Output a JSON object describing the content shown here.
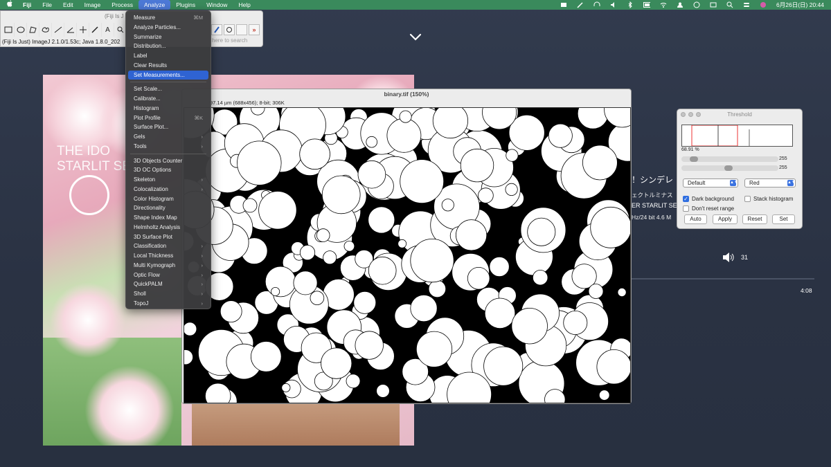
{
  "menubar": {
    "apple": "",
    "items": [
      "Fiji",
      "File",
      "Edit",
      "Image",
      "Process",
      "Analyze",
      "Plugins",
      "Window",
      "Help"
    ],
    "active": "Analyze",
    "clock": "6月26日(日) 20:44"
  },
  "ij_window": {
    "title": "(Fiji Is J",
    "status": "(Fiji Is Just) ImageJ 2.1.0/1.53c; Java 1.8.0_202",
    "search_placeholder": "here to search"
  },
  "analyze_menu": {
    "items": [
      {
        "label": "Measure",
        "shortcut": "⌘M"
      },
      {
        "label": "Analyze Particles..."
      },
      {
        "label": "Summarize"
      },
      {
        "label": "Distribution..."
      },
      {
        "label": "Label"
      },
      {
        "label": "Clear Results"
      },
      {
        "label": "Set Measurements...",
        "selected": true
      },
      {
        "sep": true
      },
      {
        "label": "Set Scale..."
      },
      {
        "label": "Calibrate..."
      },
      {
        "label": "Histogram"
      },
      {
        "label": "Plot Profile",
        "shortcut": "⌘K"
      },
      {
        "label": "Surface Plot..."
      },
      {
        "label": "Gels",
        "submenu": true
      },
      {
        "label": "Tools",
        "submenu": true
      },
      {
        "sep": true
      },
      {
        "label": "3D Objects Counter"
      },
      {
        "label": "3D OC Options"
      },
      {
        "label": "Skeleton",
        "submenu": true
      },
      {
        "label": "Colocalization",
        "submenu": true
      },
      {
        "label": "Color Histogram"
      },
      {
        "label": "Directionality"
      },
      {
        "label": "Shape Index Map"
      },
      {
        "label": "Helmholtz Analysis"
      },
      {
        "label": "3D Surface Plot"
      },
      {
        "label": "Classification",
        "submenu": true
      },
      {
        "label": "Local Thickness",
        "submenu": true
      },
      {
        "label": "Multi Kymograph",
        "submenu": true
      },
      {
        "label": "Optic Flow",
        "submenu": true
      },
      {
        "label": "QuickPALM",
        "submenu": true
      },
      {
        "label": "Sholl",
        "submenu": true
      },
      {
        "label": "TopoJ",
        "submenu": true
      }
    ]
  },
  "binary_window": {
    "title": "binary.tif (150%)",
    "info": "97.14 µm (688x456); 8-bit; 306K"
  },
  "album": {
    "title_line1": "THE IDO",
    "title_line2": "STARLIT SE"
  },
  "music": {
    "title": "！シンデレ",
    "subtitle": "ェクトルミナス",
    "album": "ER STARLIT SE",
    "format": "Hz/24 bit 4.6 M",
    "volume": "31",
    "time": "4:08"
  },
  "threshold": {
    "title": "Threshold",
    "percent": "68.91 %",
    "min_value": "255",
    "max_value": "255",
    "method": "Default",
    "mode": "Red",
    "dark_background_label": "Dark background",
    "dark_background": true,
    "stack_histogram_label": "Stack histogram",
    "stack_histogram": false,
    "dont_reset_label": "Don't reset range",
    "dont_reset": false,
    "buttons": [
      "Auto",
      "Apply",
      "Reset",
      "Set"
    ]
  },
  "colors": {
    "menubar": "#3a8a5c",
    "menu_selection": "#2f63d2",
    "desktop": "#2b3445"
  }
}
